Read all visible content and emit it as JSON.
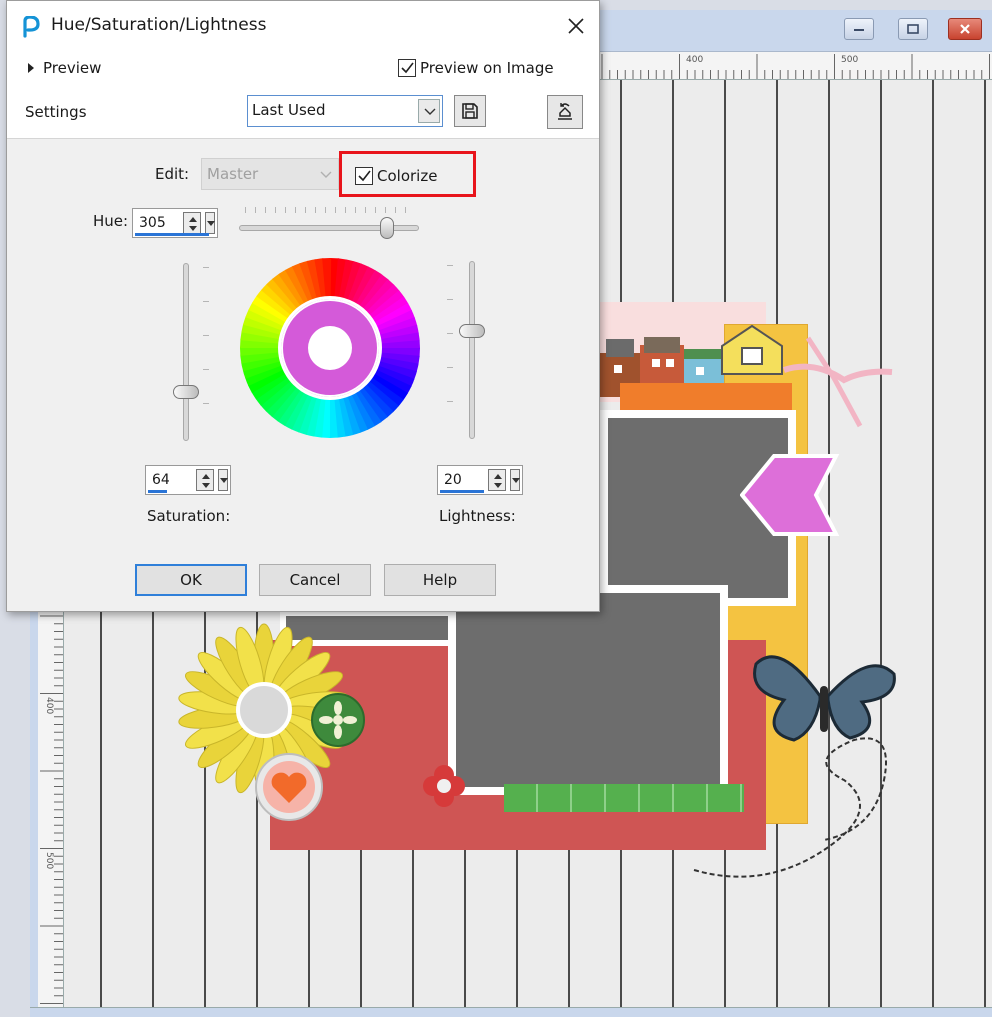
{
  "dialog": {
    "title": "Hue/Saturation/Lightness",
    "preview_label": "Preview",
    "preview_on_image_label": "Preview on Image",
    "preview_on_image_checked": true,
    "settings_label": "Settings",
    "settings_value": "Last Used"
  },
  "edit": {
    "label": "Edit:",
    "value": "Master",
    "colorize_label": "Colorize",
    "colorize_checked": true
  },
  "hue": {
    "label": "Hue:",
    "value": "305"
  },
  "saturation": {
    "label": "Saturation:",
    "value": "64"
  },
  "lightness": {
    "label": "Lightness:",
    "value": "20"
  },
  "buttons": {
    "ok": "OK",
    "cancel": "Cancel",
    "help": "Help"
  },
  "ruler": {
    "top_mark_a": "400",
    "top_mark_b": "500",
    "left_mark_a": "400",
    "left_mark_b": "500"
  },
  "colors": {
    "highlight": "#e8141b",
    "accent": "#2f7fd9",
    "colorize_tint": "#d45ad9"
  },
  "icons": [
    "paintshop-pro-icon",
    "close-icon",
    "preview-chevron-icon",
    "checkbox-check-icon",
    "save-icon",
    "reset-icon",
    "chevron-down-icon",
    "spin-arrows-icon"
  ]
}
